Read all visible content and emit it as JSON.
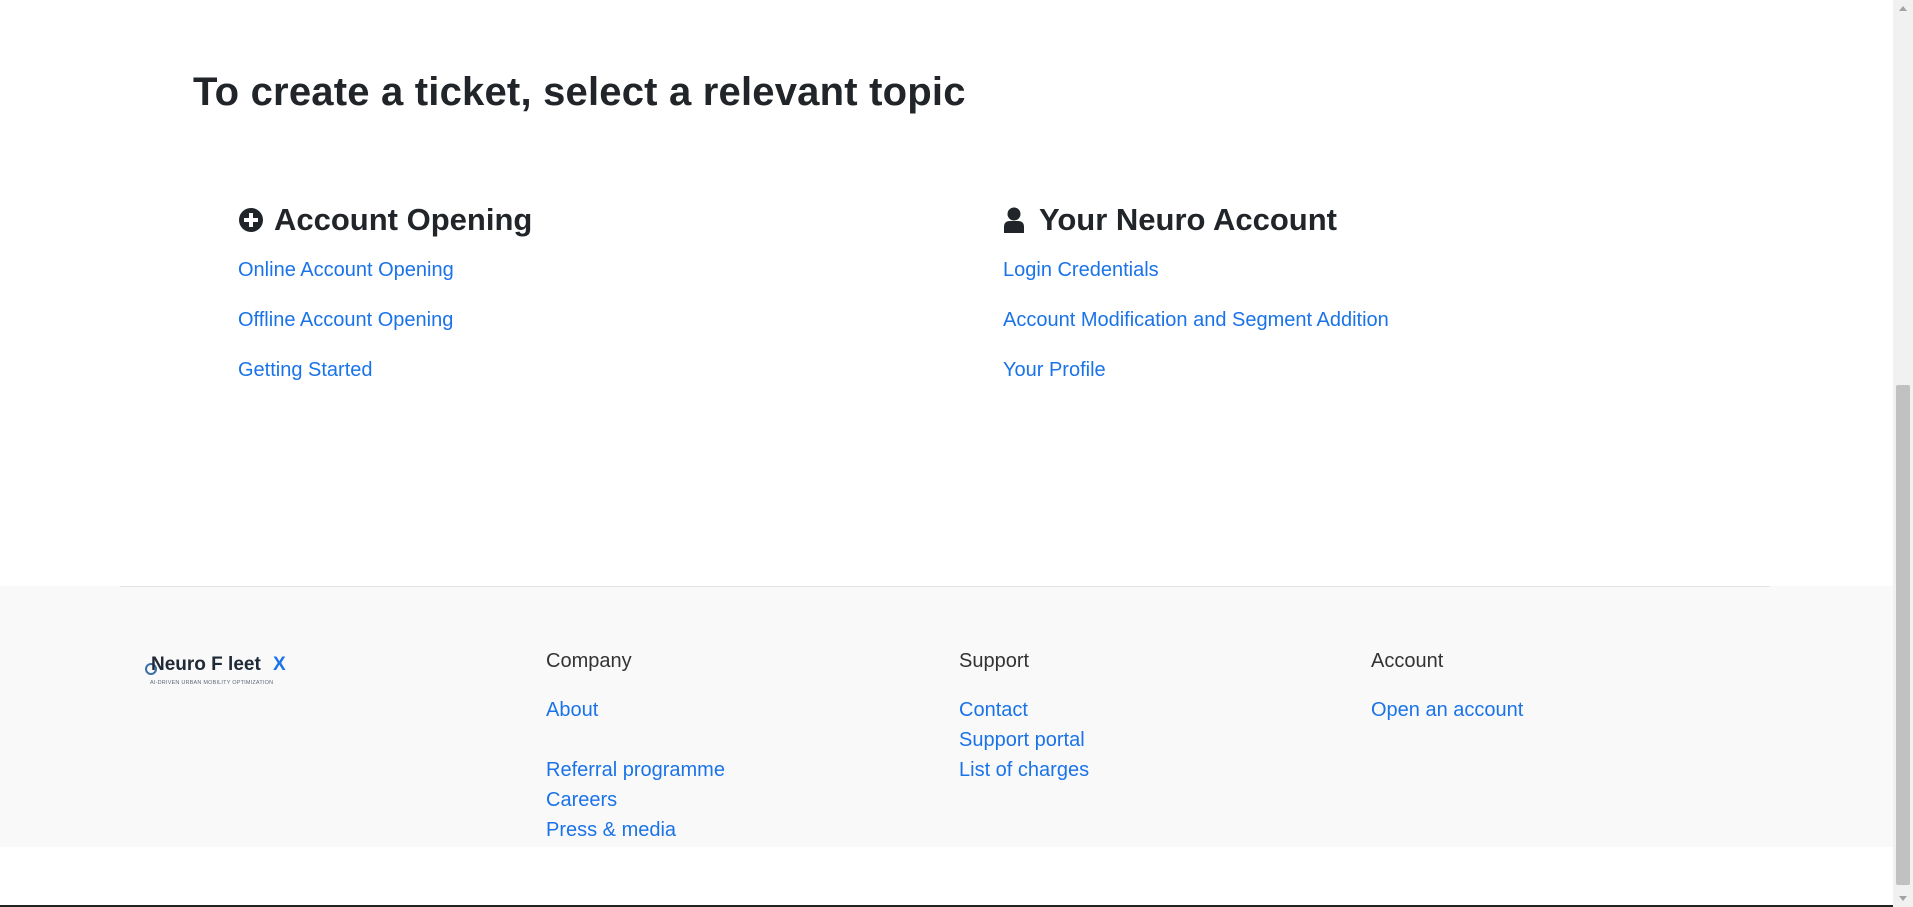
{
  "page": {
    "title": "To create a ticket, select a relevant topic"
  },
  "topics": [
    {
      "heading": "Account Opening",
      "icon": "plus-circle-icon",
      "links": [
        "Online Account Opening",
        "Offline Account Opening",
        "Getting Started"
      ]
    },
    {
      "heading": "Your Neuro Account",
      "icon": "user-icon",
      "links": [
        "Login Credentials",
        "Account Modification and Segment Addition",
        "Your Profile"
      ]
    }
  ],
  "footer": {
    "logo": {
      "name": "Neuro F leet",
      "mark": "X",
      "tagline": "AI-DRIVEN URBAN MOBILITY OPTIMIZATION"
    },
    "company": {
      "heading": "Company",
      "links": [
        "About",
        "Referral programme",
        "Careers",
        "Press & media"
      ]
    },
    "support": {
      "heading": "Support",
      "links": [
        "Contact",
        "Support portal",
        "List of charges"
      ]
    },
    "account": {
      "heading": "Account",
      "links": [
        "Open an account"
      ]
    }
  },
  "colors": {
    "link": "#1a73e8",
    "text": "#212529",
    "footer_bg": "#f9f9f9"
  }
}
